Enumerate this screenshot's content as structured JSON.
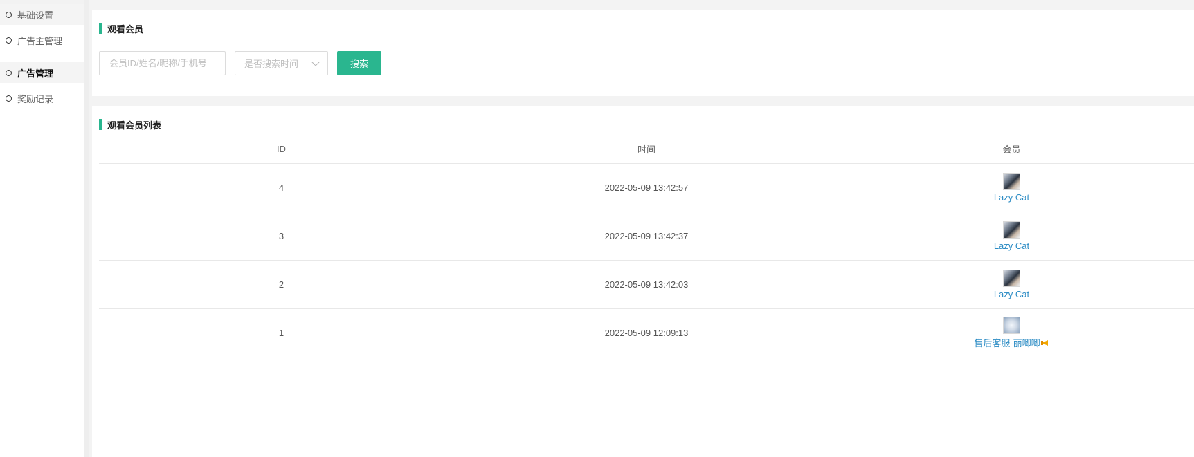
{
  "sidebar": {
    "items": [
      {
        "label": "基础设置"
      },
      {
        "label": "广告主管理"
      },
      {
        "label": "广告管理"
      },
      {
        "label": "奖励记录"
      }
    ]
  },
  "search_panel": {
    "title": "观看会员",
    "keyword_input": {
      "value": "",
      "placeholder": "会员ID/姓名/昵称/手机号"
    },
    "time_select": {
      "value": "是否搜索时间"
    },
    "search_button": "搜索"
  },
  "list_panel": {
    "title": "观看会员列表",
    "columns": [
      "ID",
      "时间",
      "会员"
    ],
    "rows": [
      {
        "id": "4",
        "time": "2022-05-09 13:42:57",
        "member": "Lazy Cat"
      },
      {
        "id": "3",
        "time": "2022-05-09 13:42:37",
        "member": "Lazy Cat"
      },
      {
        "id": "2",
        "time": "2022-05-09 13:42:03",
        "member": "Lazy Cat"
      },
      {
        "id": "1",
        "time": "2022-05-09 12:09:13",
        "member": "售后客服-丽唧唧"
      }
    ]
  },
  "colors": {
    "accent": "#2ab68f",
    "link": "#2a8bc4"
  },
  "icons": {
    "sidebar_bullet": "circle-outline-icon",
    "select_arrow": "chevron-down-icon",
    "member_badge": "horn-icon"
  }
}
